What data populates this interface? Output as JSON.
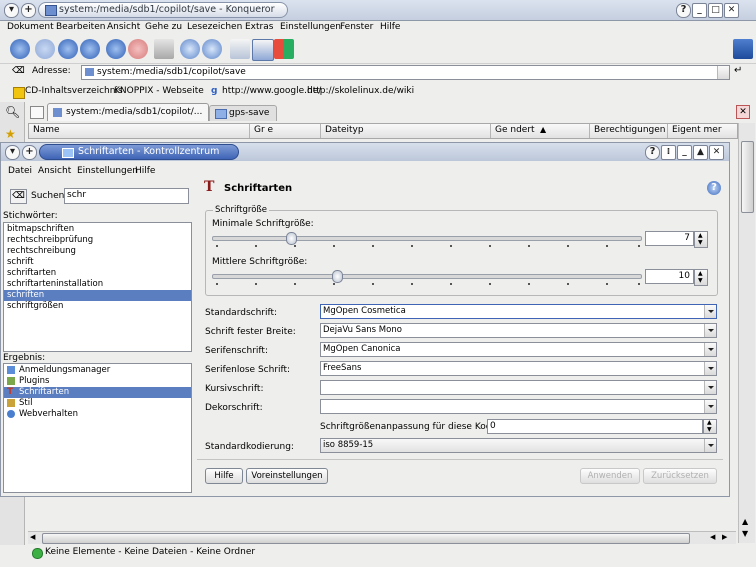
{
  "window": {
    "title": "system:/media/sdb1/copilot/save - Konqueror"
  },
  "menubar": [
    "Dokument",
    "Bearbeiten",
    "Ansicht",
    "Gehe zu",
    "Lesezeichen",
    "Extras",
    "Einstellungen",
    "Fenster",
    "Hilfe"
  ],
  "location": {
    "label": "Adresse:",
    "value": "system:/media/sdb1/copilot/save"
  },
  "bookmarks": [
    "CD-Inhaltsverzeichnis",
    "KNOPPIX - Webseite",
    "http://www.google.de/",
    "http://skolelinux.de/wiki"
  ],
  "tabs": [
    "system:/media/sdb1/copilot/...",
    "gps-save"
  ],
  "columns": [
    "Name",
    "Gr e",
    "Dateityp",
    "Ge ndert",
    "Berechtigungen",
    "Eigent mer"
  ],
  "dialog": {
    "title": "Schriftarten - Kontrollzentrum",
    "menubar": [
      "Datei",
      "Ansicht",
      "Einstellungen",
      "Hilfe"
    ],
    "search": {
      "label": "Suchen:",
      "value": "schr"
    },
    "keywords_label": "Stichwörter:",
    "keywords": [
      "bitmapschriften",
      "rechtschreibprüfung",
      "rechtschreibung",
      "schrift",
      "schriftarten",
      "schriftarteninstallation",
      "schriften",
      "schriftgrößen"
    ],
    "keywords_selected": 6,
    "results_label": "Ergebnis:",
    "results": [
      "Anmeldungsmanager",
      "Plugins",
      "Schriftarten",
      "Stil",
      "Webverhalten"
    ],
    "results_selected": 2,
    "panel": {
      "title": "Schriftarten",
      "group_title": "Schriftgröße",
      "min_size_label": "Minimale Schriftgröße:",
      "min_size_value": "7",
      "mid_size_label": "Mittlere Schriftgröße:",
      "mid_size_value": "10",
      "fonts": [
        {
          "label": "Standardschrift:",
          "value": "MgOpen Cosmetica"
        },
        {
          "label": "Schrift fester Breite:",
          "value": "DejaVu Sans Mono"
        },
        {
          "label": "Serifenschrift:",
          "value": "MgOpen Canonica"
        },
        {
          "label": "Serifenlose Schrift:",
          "value": "FreeSans"
        },
        {
          "label": "Kursivschrift:",
          "value": ""
        },
        {
          "label": "Dekorschrift:",
          "value": ""
        }
      ],
      "adjust_label": "Schriftgrößenanpassung für diese Kodierung:",
      "adjust_value": "0",
      "encoding_label": "Standardkodierung:",
      "encoding_value": "iso 8859-15"
    },
    "buttons": {
      "help": "Hilfe",
      "defaults": "Voreinstellungen",
      "apply": "Anwenden",
      "reset": "Zurücksetzen"
    }
  },
  "status": "Keine Elemente - Keine Dateien - Keine Ordner",
  "colors": {
    "selection": "#5a7ebf",
    "title_active": "#3f64b6"
  }
}
